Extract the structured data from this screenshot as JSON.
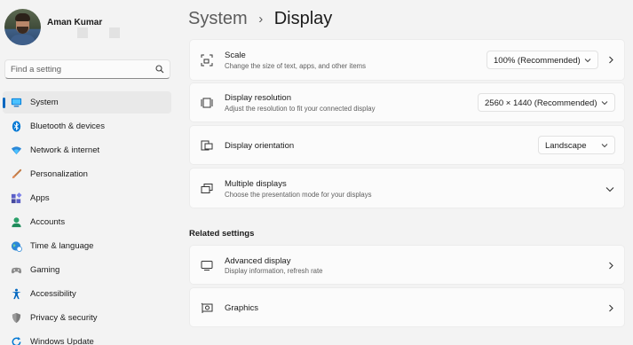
{
  "profile": {
    "name": "Aman Kumar"
  },
  "search": {
    "placeholder": "Find a setting"
  },
  "sidebar": {
    "items": [
      {
        "label": "System",
        "icon": "system-icon",
        "selected": true
      },
      {
        "label": "Bluetooth & devices",
        "icon": "bluetooth-icon"
      },
      {
        "label": "Network & internet",
        "icon": "wifi-icon"
      },
      {
        "label": "Personalization",
        "icon": "brush-icon"
      },
      {
        "label": "Apps",
        "icon": "apps-icon"
      },
      {
        "label": "Accounts",
        "icon": "accounts-icon"
      },
      {
        "label": "Time & language",
        "icon": "globe-clock-icon"
      },
      {
        "label": "Gaming",
        "icon": "gamepad-icon"
      },
      {
        "label": "Accessibility",
        "icon": "accessibility-icon"
      },
      {
        "label": "Privacy & security",
        "icon": "shield-icon"
      },
      {
        "label": "Windows Update",
        "icon": "windows-update-icon"
      }
    ]
  },
  "breadcrumb": {
    "parent": "System",
    "separator": "›",
    "current": "Display"
  },
  "settings": {
    "scale": {
      "title": "Scale",
      "description": "Change the size of text, apps, and other items",
      "value": "100% (Recommended)"
    },
    "resolution": {
      "title": "Display resolution",
      "description": "Adjust the resolution to fit your connected display",
      "value": "2560 × 1440 (Recommended)"
    },
    "orientation": {
      "title": "Display orientation",
      "value": "Landscape"
    },
    "multiple": {
      "title": "Multiple displays",
      "description": "Choose the presentation mode for your displays"
    }
  },
  "related": {
    "heading": "Related settings",
    "advanced": {
      "title": "Advanced display",
      "description": "Display information, refresh rate"
    },
    "graphics": {
      "title": "Graphics"
    }
  },
  "colors": {
    "accent": "#0067c0",
    "background": "#f3f3f3",
    "card": "#fbfbfb"
  }
}
